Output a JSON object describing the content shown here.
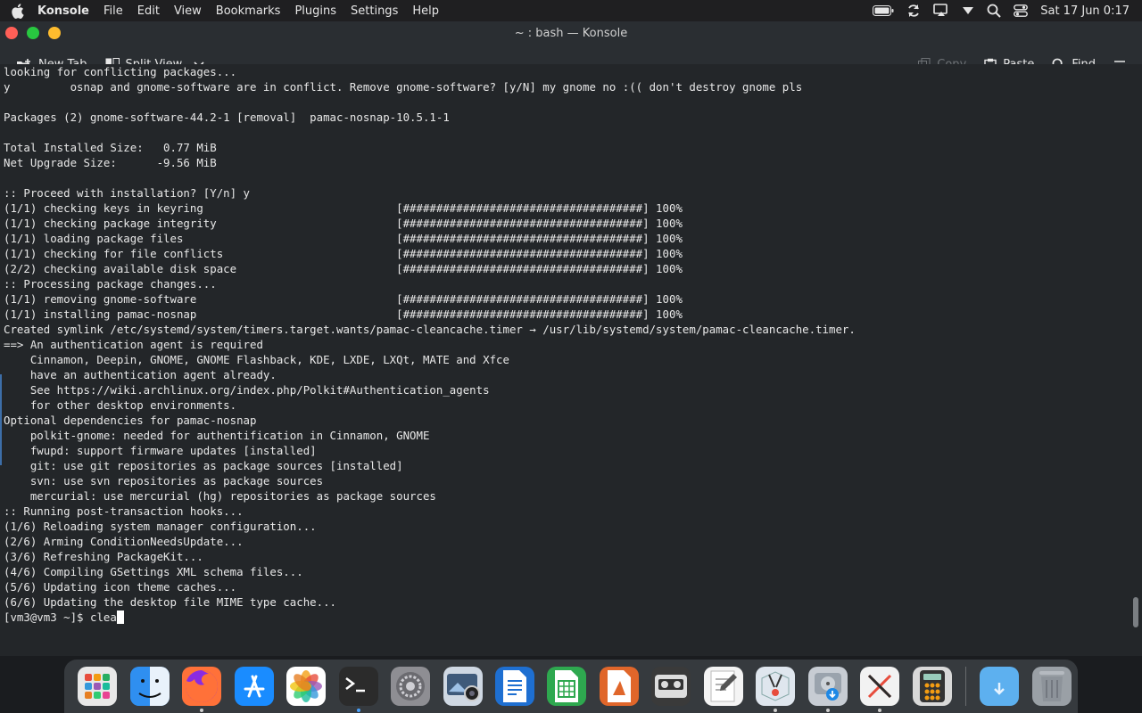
{
  "menubar": {
    "app_name": "Konsole",
    "items": [
      "File",
      "Edit",
      "View",
      "Bookmarks",
      "Plugins",
      "Settings",
      "Help"
    ],
    "clock": "Sat 17 Jun 0:17",
    "status_icons": [
      "battery-icon",
      "sync-icon",
      "screen-mirror-icon",
      "wifi-dropdown-icon",
      "spotlight-search-icon",
      "control-center-icon"
    ]
  },
  "window": {
    "title": "~ : bash — Konsole"
  },
  "toolbar": {
    "new_tab": "New Tab",
    "split_view": "Split View",
    "copy": "Copy",
    "paste": "Paste",
    "find": "Find"
  },
  "terminal": {
    "output": "looking for conflicting packages...\ny         osnap and gnome-software are in conflict. Remove gnome-software? [y/N] my gnome no :(( don't destroy gnome pls\n\nPackages (2) gnome-software-44.2-1 [removal]  pamac-nosnap-10.5.1-1\n\nTotal Installed Size:   0.77 MiB\nNet Upgrade Size:      -9.56 MiB\n\n:: Proceed with installation? [Y/n] y\n(1/1) checking keys in keyring                             [####################################] 100%\n(1/1) checking package integrity                           [####################################] 100%\n(1/1) loading package files                                [####################################] 100%\n(1/1) checking for file conflicts                          [####################################] 100%\n(2/2) checking available disk space                        [####################################] 100%\n:: Processing package changes...\n(1/1) removing gnome-software                              [####################################] 100%\n(1/1) installing pamac-nosnap                              [####################################] 100%\nCreated symlink /etc/systemd/system/timers.target.wants/pamac-cleancache.timer → /usr/lib/systemd/system/pamac-cleancache.timer.\n==> An authentication agent is required\n    Cinnamon, Deepin, GNOME, GNOME Flashback, KDE, LXDE, LXQt, MATE and Xfce\n    have an authentication agent already.\n    See https://wiki.archlinux.org/index.php/Polkit#Authentication_agents\n    for other desktop environments.\nOptional dependencies for pamac-nosnap\n    polkit-gnome: needed for authentification in Cinnamon, GNOME\n    fwupd: support firmware updates [installed]\n    git: use git repositories as package sources [installed]\n    svn: use svn repositories as package sources\n    mercurial: use mercurial (hg) repositories as package sources\n:: Running post-transaction hooks...\n(1/6) Reloading system manager configuration...\n(2/6) Arming ConditionNeedsUpdate...\n(3/6) Refreshing PackageKit...\n(4/6) Compiling GSettings XML schema files...\n(5/6) Updating icon theme caches...\n(6/6) Updating the desktop file MIME type cache...",
    "prompt": "[vm3@vm3 ~]$ ",
    "input": "clea"
  },
  "dock": {
    "items": [
      {
        "name": "launchpad-icon",
        "color": "#e8e8e8",
        "running": false
      },
      {
        "name": "finder-icon",
        "color": "#2f8ff0",
        "running": false
      },
      {
        "name": "firefox-icon",
        "color": "#ff7139",
        "running": true
      },
      {
        "name": "app-store-icon",
        "color": "#1a8cff",
        "running": false
      },
      {
        "name": "photos-icon",
        "color": "#ffffff",
        "running": false
      },
      {
        "name": "terminal-icon",
        "color": "#2b2b2b",
        "running": true
      },
      {
        "name": "system-preferences-icon",
        "color": "#8e8e93",
        "running": false
      },
      {
        "name": "screenshot-icon",
        "color": "#cfd8e3",
        "running": false
      },
      {
        "name": "writer-icon",
        "color": "#1e6fd1",
        "running": false
      },
      {
        "name": "calc-icon",
        "color": "#2ea84f",
        "running": false
      },
      {
        "name": "impress-icon",
        "color": "#e0662a",
        "running": false
      },
      {
        "name": "tape-icon",
        "color": "#3a3a3a",
        "running": false
      },
      {
        "name": "text-editor-icon",
        "color": "#f4f4f4",
        "running": false
      },
      {
        "name": "archive-tool-icon",
        "color": "#dfe6ee",
        "running": true
      },
      {
        "name": "disk-utility-icon",
        "color": "#c7ccd3",
        "running": true
      },
      {
        "name": "xcode-x-icon",
        "color": "#f2f2f2",
        "running": true
      },
      {
        "name": "calculator-icon",
        "color": "#d9d9d9",
        "running": false
      },
      {
        "name": "downloads-folder-icon",
        "color": "#5db0ef",
        "running": false
      },
      {
        "name": "trash-icon",
        "color": "#9aa0a6",
        "running": false
      }
    ]
  }
}
